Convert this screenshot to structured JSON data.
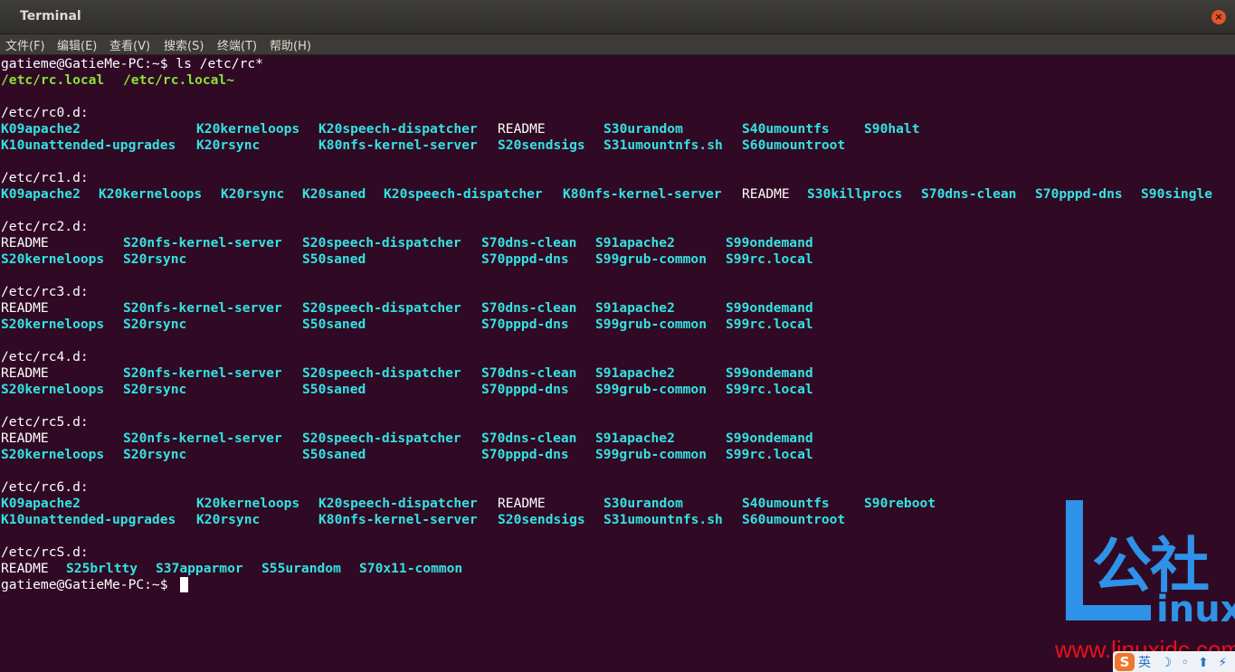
{
  "window": {
    "title": "Terminal",
    "close_glyph": "×"
  },
  "menu": [
    {
      "label": "文件(F)"
    },
    {
      "label": "编辑(E)"
    },
    {
      "label": "查看(V)"
    },
    {
      "label": "搜索(S)"
    },
    {
      "label": "终端(T)"
    },
    {
      "label": "帮助(H)"
    }
  ],
  "colors": {
    "terminal_bg": "#300a24",
    "dir_color": "#34e2e2",
    "exec_color": "#8ae234",
    "text_color": "#ffffff",
    "watermark_blue": "#2e92e8",
    "watermark_red": "#e8101e"
  },
  "terminal": {
    "lines": [
      [
        {
          "t": "gatieme@GatieMe-PC:~$ ls /etc/rc*",
          "s": "w",
          "c": 0
        }
      ],
      [
        {
          "t": "/etc/rc.local",
          "s": "g",
          "c": 0
        },
        {
          "t": "/etc/rc.local~",
          "s": "g",
          "c": 15
        }
      ],
      [],
      [
        {
          "t": "/etc/rc0.d:",
          "s": "w",
          "c": 0
        }
      ],
      [
        {
          "t": "K09apache2",
          "s": "c",
          "c": 0
        },
        {
          "t": "K20kerneloops",
          "s": "c",
          "c": 24
        },
        {
          "t": "K20speech-dispatcher",
          "s": "c",
          "c": 39
        },
        {
          "t": "README",
          "s": "w",
          "c": 61
        },
        {
          "t": "S30urandom",
          "s": "c",
          "c": 74
        },
        {
          "t": "S40umountfs",
          "s": "c",
          "c": 91
        },
        {
          "t": "S90halt",
          "s": "c",
          "c": 106
        }
      ],
      [
        {
          "t": "K10unattended-upgrades",
          "s": "c",
          "c": 0
        },
        {
          "t": "K20rsync",
          "s": "c",
          "c": 24
        },
        {
          "t": "K80nfs-kernel-server",
          "s": "c",
          "c": 39
        },
        {
          "t": "S20sendsigs",
          "s": "c",
          "c": 61
        },
        {
          "t": "S31umountnfs.sh",
          "s": "c",
          "c": 74
        },
        {
          "t": "S60umountroot",
          "s": "c",
          "c": 91
        }
      ],
      [],
      [
        {
          "t": "/etc/rc1.d:",
          "s": "w",
          "c": 0
        }
      ],
      [
        {
          "t": "K09apache2",
          "s": "c",
          "c": 0
        },
        {
          "t": "K20kerneloops",
          "s": "c",
          "c": 12
        },
        {
          "t": "K20rsync",
          "s": "c",
          "c": 27
        },
        {
          "t": "K20saned",
          "s": "c",
          "c": 37
        },
        {
          "t": "K20speech-dispatcher",
          "s": "c",
          "c": 47
        },
        {
          "t": "K80nfs-kernel-server",
          "s": "c",
          "c": 69
        },
        {
          "t": "README",
          "s": "w",
          "c": 91
        },
        {
          "t": "S30killprocs",
          "s": "c",
          "c": 99
        },
        {
          "t": "S70dns-clean",
          "s": "c",
          "c": 113
        },
        {
          "t": "S70pppd-dns",
          "s": "c",
          "c": 127
        },
        {
          "t": "S90single",
          "s": "c",
          "c": 140
        }
      ],
      [],
      [
        {
          "t": "/etc/rc2.d:",
          "s": "w",
          "c": 0
        }
      ],
      [
        {
          "t": "README",
          "s": "w",
          "c": 0
        },
        {
          "t": "S20nfs-kernel-server",
          "s": "c",
          "c": 15
        },
        {
          "t": "S20speech-dispatcher",
          "s": "c",
          "c": 37
        },
        {
          "t": "S70dns-clean",
          "s": "c",
          "c": 59
        },
        {
          "t": "S91apache2",
          "s": "c",
          "c": 73
        },
        {
          "t": "S99ondemand",
          "s": "c",
          "c": 89
        }
      ],
      [
        {
          "t": "S20kerneloops",
          "s": "c",
          "c": 0
        },
        {
          "t": "S20rsync",
          "s": "c",
          "c": 15
        },
        {
          "t": "S50saned",
          "s": "c",
          "c": 37
        },
        {
          "t": "S70pppd-dns",
          "s": "c",
          "c": 59
        },
        {
          "t": "S99grub-common",
          "s": "c",
          "c": 73
        },
        {
          "t": "S99rc.local",
          "s": "c",
          "c": 89
        }
      ],
      [],
      [
        {
          "t": "/etc/rc3.d:",
          "s": "w",
          "c": 0
        }
      ],
      [
        {
          "t": "README",
          "s": "w",
          "c": 0
        },
        {
          "t": "S20nfs-kernel-server",
          "s": "c",
          "c": 15
        },
        {
          "t": "S20speech-dispatcher",
          "s": "c",
          "c": 37
        },
        {
          "t": "S70dns-clean",
          "s": "c",
          "c": 59
        },
        {
          "t": "S91apache2",
          "s": "c",
          "c": 73
        },
        {
          "t": "S99ondemand",
          "s": "c",
          "c": 89
        }
      ],
      [
        {
          "t": "S20kerneloops",
          "s": "c",
          "c": 0
        },
        {
          "t": "S20rsync",
          "s": "c",
          "c": 15
        },
        {
          "t": "S50saned",
          "s": "c",
          "c": 37
        },
        {
          "t": "S70pppd-dns",
          "s": "c",
          "c": 59
        },
        {
          "t": "S99grub-common",
          "s": "c",
          "c": 73
        },
        {
          "t": "S99rc.local",
          "s": "c",
          "c": 89
        }
      ],
      [],
      [
        {
          "t": "/etc/rc4.d:",
          "s": "w",
          "c": 0
        }
      ],
      [
        {
          "t": "README",
          "s": "w",
          "c": 0
        },
        {
          "t": "S20nfs-kernel-server",
          "s": "c",
          "c": 15
        },
        {
          "t": "S20speech-dispatcher",
          "s": "c",
          "c": 37
        },
        {
          "t": "S70dns-clean",
          "s": "c",
          "c": 59
        },
        {
          "t": "S91apache2",
          "s": "c",
          "c": 73
        },
        {
          "t": "S99ondemand",
          "s": "c",
          "c": 89
        }
      ],
      [
        {
          "t": "S20kerneloops",
          "s": "c",
          "c": 0
        },
        {
          "t": "S20rsync",
          "s": "c",
          "c": 15
        },
        {
          "t": "S50saned",
          "s": "c",
          "c": 37
        },
        {
          "t": "S70pppd-dns",
          "s": "c",
          "c": 59
        },
        {
          "t": "S99grub-common",
          "s": "c",
          "c": 73
        },
        {
          "t": "S99rc.local",
          "s": "c",
          "c": 89
        }
      ],
      [],
      [
        {
          "t": "/etc/rc5.d:",
          "s": "w",
          "c": 0
        }
      ],
      [
        {
          "t": "README",
          "s": "w",
          "c": 0
        },
        {
          "t": "S20nfs-kernel-server",
          "s": "c",
          "c": 15
        },
        {
          "t": "S20speech-dispatcher",
          "s": "c",
          "c": 37
        },
        {
          "t": "S70dns-clean",
          "s": "c",
          "c": 59
        },
        {
          "t": "S91apache2",
          "s": "c",
          "c": 73
        },
        {
          "t": "S99ondemand",
          "s": "c",
          "c": 89
        }
      ],
      [
        {
          "t": "S20kerneloops",
          "s": "c",
          "c": 0
        },
        {
          "t": "S20rsync",
          "s": "c",
          "c": 15
        },
        {
          "t": "S50saned",
          "s": "c",
          "c": 37
        },
        {
          "t": "S70pppd-dns",
          "s": "c",
          "c": 59
        },
        {
          "t": "S99grub-common",
          "s": "c",
          "c": 73
        },
        {
          "t": "S99rc.local",
          "s": "c",
          "c": 89
        }
      ],
      [],
      [
        {
          "t": "/etc/rc6.d:",
          "s": "w",
          "c": 0
        }
      ],
      [
        {
          "t": "K09apache2",
          "s": "c",
          "c": 0
        },
        {
          "t": "K20kerneloops",
          "s": "c",
          "c": 24
        },
        {
          "t": "K20speech-dispatcher",
          "s": "c",
          "c": 39
        },
        {
          "t": "README",
          "s": "w",
          "c": 61
        },
        {
          "t": "S30urandom",
          "s": "c",
          "c": 74
        },
        {
          "t": "S40umountfs",
          "s": "c",
          "c": 91
        },
        {
          "t": "S90reboot",
          "s": "c",
          "c": 106
        }
      ],
      [
        {
          "t": "K10unattended-upgrades",
          "s": "c",
          "c": 0
        },
        {
          "t": "K20rsync",
          "s": "c",
          "c": 24
        },
        {
          "t": "K80nfs-kernel-server",
          "s": "c",
          "c": 39
        },
        {
          "t": "S20sendsigs",
          "s": "c",
          "c": 61
        },
        {
          "t": "S31umountnfs.sh",
          "s": "c",
          "c": 74
        },
        {
          "t": "S60umountroot",
          "s": "c",
          "c": 91
        }
      ],
      [],
      [
        {
          "t": "/etc/rcS.d:",
          "s": "w",
          "c": 0
        }
      ],
      [
        {
          "t": "README",
          "s": "w",
          "c": 0
        },
        {
          "t": "S25brltty",
          "s": "c",
          "c": 8
        },
        {
          "t": "S37apparmor",
          "s": "c",
          "c": 19
        },
        {
          "t": "S55urandom",
          "s": "c",
          "c": 32
        },
        {
          "t": "S70x11-common",
          "s": "c",
          "c": 44
        }
      ],
      [
        {
          "t": "gatieme@GatieMe-PC:~$ ",
          "s": "w",
          "c": 0
        }
      ]
    ],
    "prompt_text": "gatieme@GatieMe-PC:~$ "
  },
  "watermark": {
    "chinese": "公社",
    "inux": "inux",
    "url": "www.linuxidc.com"
  },
  "tray": {
    "logo": "S",
    "text": "英 ☽ ◦ ⬆ ⚡"
  }
}
